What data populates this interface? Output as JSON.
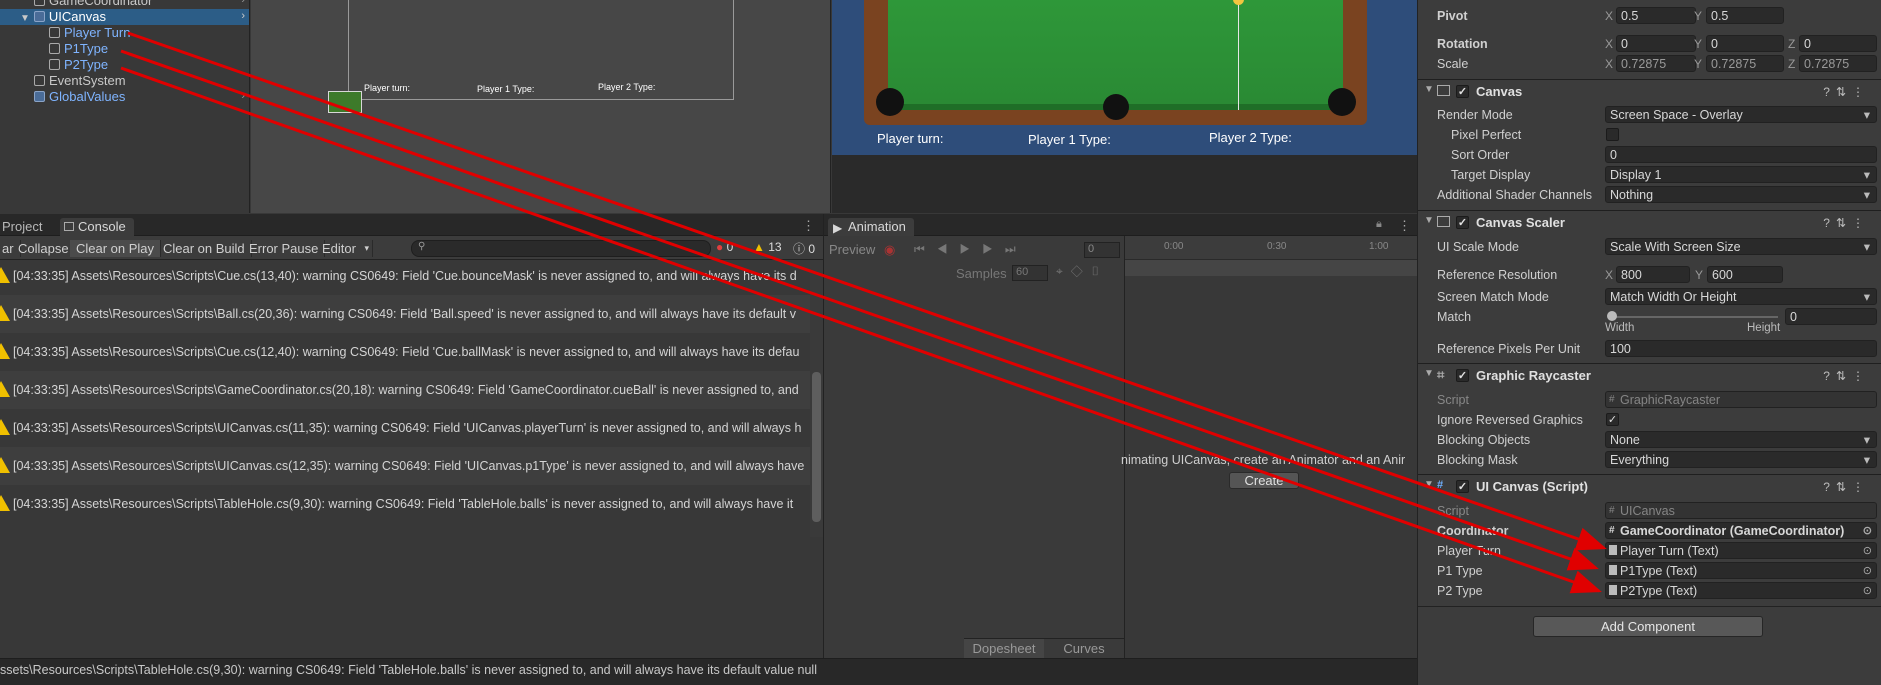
{
  "hierarchy": {
    "items": [
      {
        "label": "GameCoordinator"
      },
      {
        "label": "UICanvas"
      },
      {
        "label": "Player Turn"
      },
      {
        "label": "P1Type"
      },
      {
        "label": "P2Type"
      },
      {
        "label": "EventSystem"
      },
      {
        "label": "GlobalValues"
      }
    ]
  },
  "scene": {
    "labels": [
      "Player turn:",
      "Player 1 Type:",
      "Player 2 Type:"
    ]
  },
  "game": {
    "labels": [
      "Player turn:",
      "Player 1 Type:",
      "Player 2 Type:"
    ]
  },
  "console": {
    "tabs": [
      "Project",
      "Console"
    ],
    "toolbar": [
      "ar",
      "Collapse",
      "Clear on Play",
      "Clear on Build",
      "Error Pause",
      "Editor"
    ],
    "counts": {
      "errors": "0",
      "warnings": "13",
      "messages": "0"
    },
    "logs": [
      "[04:33:35] Assets\\Resources\\Scripts\\Cue.cs(13,40): warning CS0649: Field 'Cue.bounceMask' is never assigned to, and will always have its d",
      "[04:33:35] Assets\\Resources\\Scripts\\Ball.cs(20,36): warning CS0649: Field 'Ball.speed' is never assigned to, and will always have its default v",
      "[04:33:35] Assets\\Resources\\Scripts\\Cue.cs(12,40): warning CS0649: Field 'Cue.ballMask' is never assigned to, and will always have its defau",
      "[04:33:35] Assets\\Resources\\Scripts\\GameCoordinator.cs(20,18): warning CS0649: Field 'GameCoordinator.cueBall' is never assigned to, and",
      "[04:33:35] Assets\\Resources\\Scripts\\UICanvas.cs(11,35): warning CS0649: Field 'UICanvas.playerTurn' is never assigned to, and will always h",
      "[04:33:35] Assets\\Resources\\Scripts\\UICanvas.cs(12,35): warning CS0649: Field 'UICanvas.p1Type' is never assigned to, and will always have",
      "[04:33:35] Assets\\Resources\\Scripts\\TableHole.cs(9,30): warning CS0649: Field 'TableHole.balls' is never assigned to, and will always have it"
    ]
  },
  "animation": {
    "tab": "Animation",
    "preview": "Preview",
    "frame": "0",
    "samples_label": "Samples",
    "samples": "60",
    "ticks": [
      "0:00",
      "0:30",
      "1:00"
    ],
    "message": "nimating UICanvas, create an Animator and an Anir",
    "create": "Create",
    "bottom_tabs": [
      "Dopesheet",
      "Curves"
    ]
  },
  "status": "ssets\\Resources\\Scripts\\TableHole.cs(9,30): warning CS0649: Field 'TableHole.balls' is never assigned to, and will always have its default value null",
  "inspector": {
    "rect": [
      {
        "label": "Pivot",
        "x": "0.5",
        "y": "0.5"
      },
      {
        "label": "Rotation",
        "x": "0",
        "y": "0",
        "z": "0"
      },
      {
        "label": "Scale",
        "x": "0.72875",
        "y": "0.72875",
        "z": "0.72875"
      }
    ],
    "canvas": {
      "title": "Canvas",
      "rows": [
        {
          "label": "Render Mode",
          "value": "Screen Space - Overlay"
        },
        {
          "label": "Pixel Perfect",
          "value": ""
        },
        {
          "label": "Sort Order",
          "value": "0"
        },
        {
          "label": "Target Display",
          "value": "Display 1"
        },
        {
          "label": "Additional Shader Channels",
          "value": "Nothing"
        }
      ]
    },
    "scaler": {
      "title": "Canvas Scaler",
      "ui_scale_mode": "Scale With Screen Size",
      "ref_res_label": "Reference Resolution",
      "ref_x": "800",
      "ref_y": "600",
      "match_mode_label": "Screen Match Mode",
      "match_mode": "Match Width Or Height",
      "match_label": "Match",
      "match_value": "0",
      "width": "Width",
      "height": "Height",
      "ppu_label": "Reference Pixels Per Unit",
      "ppu": "100",
      "ui_scale_label": "UI Scale Mode"
    },
    "raycaster": {
      "title": "Graphic Raycaster",
      "script_label": "Script",
      "script": "GraphicRaycaster",
      "ignore_label": "Ignore Reversed Graphics",
      "blocking_objects_label": "Blocking Objects",
      "blocking_objects": "None",
      "blocking_mask_label": "Blocking Mask",
      "blocking_mask": "Everything"
    },
    "uicanvas": {
      "title": "UI Canvas (Script)",
      "script_label": "Script",
      "script": "UICanvas",
      "coord_label": "Coordinator",
      "coord": "GameCoordinator (GameCoordinator)",
      "pt_label": "Player Turn",
      "pt": "Player Turn (Text)",
      "p1_label": "P1 Type",
      "p1": "P1Type (Text)",
      "p2_label": "P2 Type",
      "p2": "P2Type (Text)"
    },
    "add_component": "Add Component",
    "axes": {
      "x": "X",
      "y": "Y",
      "z": "Z"
    }
  }
}
